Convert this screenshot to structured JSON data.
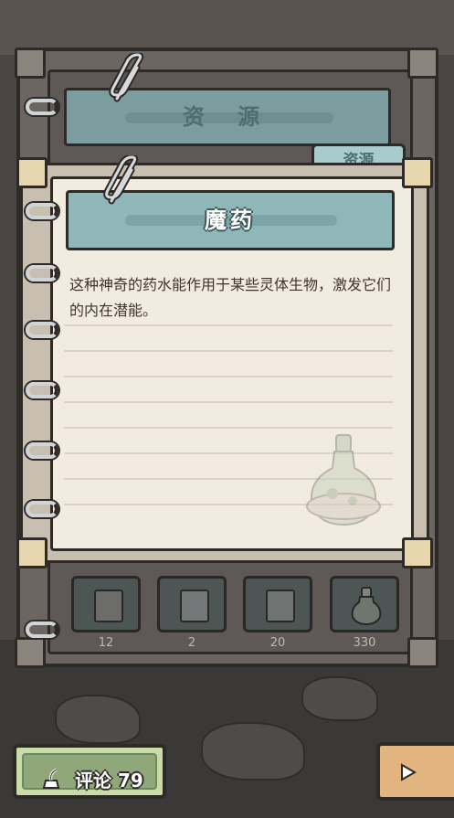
{
  "back_page": {
    "title": "资 源"
  },
  "tab": {
    "label": "资源"
  },
  "item": {
    "title": "魔药",
    "description": "这种神奇的药水能作用于某些灵体生物，激发它们的内在潜能。"
  },
  "inventory": [
    {
      "icon": "book-icon",
      "count": "12"
    },
    {
      "icon": "spellbook-icon",
      "count": "2"
    },
    {
      "icon": "tome-icon",
      "count": "20"
    },
    {
      "icon": "potion-icon",
      "count": "330"
    }
  ],
  "comment_button": {
    "label": "评论 79",
    "icon": "quill-icon"
  },
  "colors": {
    "title_bar": "#8fb6b9",
    "paper": "#f2ebdf",
    "comment_green": "#8fa779",
    "next_orange": "#e2b47f"
  }
}
